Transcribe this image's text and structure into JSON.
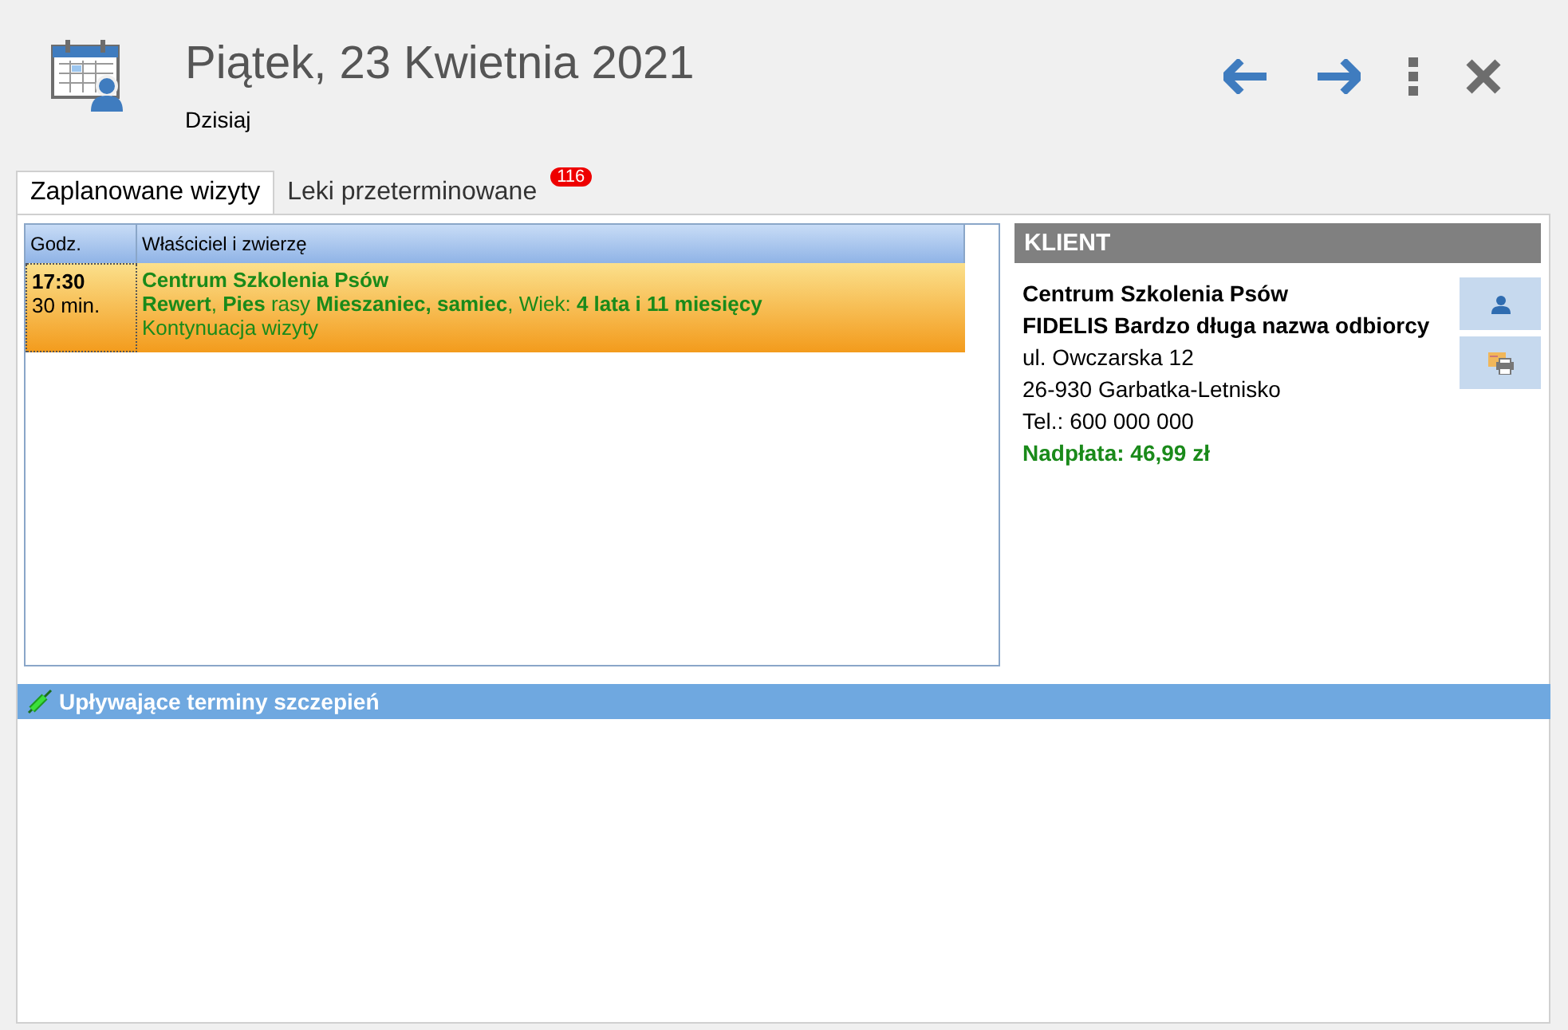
{
  "header": {
    "title": "Piątek, 23 Kwietnia 2021",
    "subtitle": "Dzisiaj"
  },
  "tabs": [
    {
      "label": "Zaplanowane wizyty",
      "selected": true
    },
    {
      "label": "Leki przeterminowane",
      "selected": false,
      "badge": "116"
    }
  ],
  "visits": {
    "columns": [
      "Godz.",
      "Właściciel i zwierzę"
    ],
    "rows": [
      {
        "time": "17:30",
        "duration": "30 min.",
        "owner": "Centrum Szkolenia Psów",
        "animal": "**Rewert**, **Pies** rasy **Mieszaniec, samiec**, Wiek: **4 lata i 11 miesięcy**",
        "note": "Kontynuacja wizyty",
        "selected": true
      }
    ]
  },
  "client": {
    "heading": "KLIENT",
    "lines": [
      {
        "text": "Centrum Szkolenia Psów",
        "kind": "bold"
      },
      {
        "text": "FIDELIS Bardzo długa nazwa odbiorcy",
        "kind": "bold"
      },
      {
        "text": "ul. Owczarska 12",
        "kind": "plain"
      },
      {
        "text": "26-930  Garbatka-Letnisko",
        "kind": "plain"
      },
      {
        "text": "Tel.: 600 000 000",
        "kind": "plain"
      },
      {
        "text": "Nadpłata: 46,99 zł",
        "kind": "balance"
      }
    ]
  },
  "vaccinations": {
    "heading": "Upływające terminy szczepień"
  }
}
